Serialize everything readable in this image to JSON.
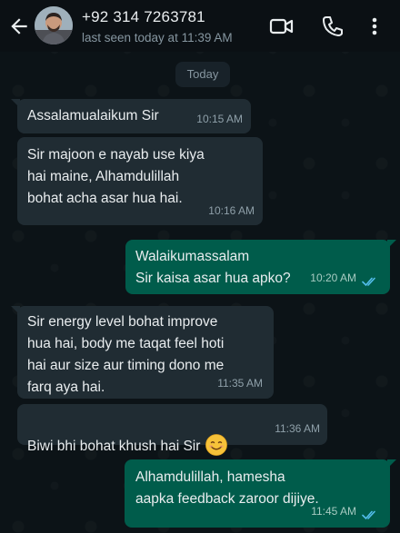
{
  "header": {
    "contact_name": "+92 314 7263781",
    "status": "last seen today at 11:39 AM"
  },
  "date_separator": "Today",
  "messages": [
    {
      "direction": "incoming",
      "text": "Assalamualaikum Sir",
      "time": "10:15 AM"
    },
    {
      "direction": "incoming",
      "text": "Sir majoon e nayab use kiya\nhai maine, Alhamdulillah\nbohat acha asar hua hai.",
      "time": "10:16 AM"
    },
    {
      "direction": "outgoing",
      "text": "Walaikumassalam\nSir kaisa asar hua apko?",
      "time": "10:20 AM",
      "status": "read"
    },
    {
      "direction": "incoming",
      "text": "Sir energy level bohat improve\nhua hai, body me taqat feel hoti\nhai aur size aur timing dono me\nfarq aya hai.",
      "time": "11:35 AM"
    },
    {
      "direction": "incoming",
      "text": "Biwi bhi bohat khush hai Sir",
      "time": "11:36 AM",
      "emoji": "smiling-face-emoji"
    },
    {
      "direction": "outgoing",
      "text": "Alhamdulillah, hamesha\naapka feedback zaroor dijiye.",
      "time": "11:45 AM",
      "status": "read"
    }
  ],
  "colors": {
    "background": "#0b1014",
    "incoming_bubble": "#202c33",
    "outgoing_bubble": "#005c4b",
    "read_ticks": "#53bdeb",
    "secondary_text": "#8696a0"
  }
}
